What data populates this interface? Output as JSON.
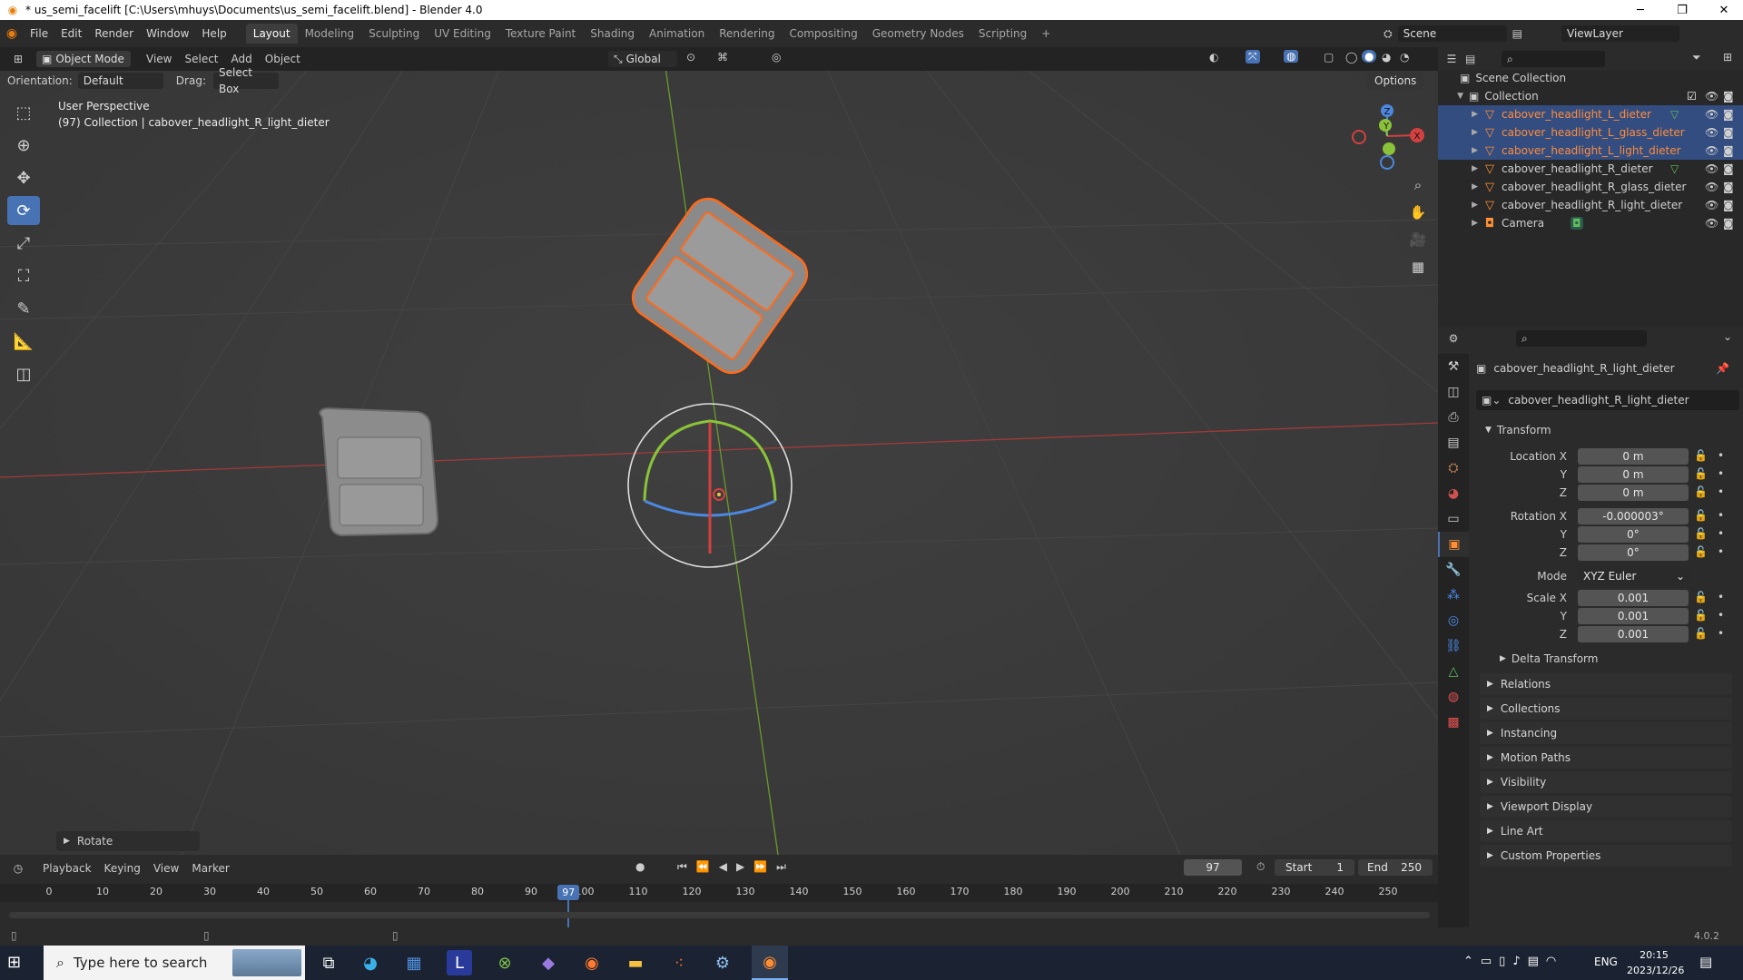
{
  "window": {
    "title": "* us_semi_facelift [C:\\Users\\mhuys\\Documents\\us_semi_facelift.blend] - Blender 4.0",
    "minimize": "─",
    "maximize": "❐",
    "close": "✕"
  },
  "menus": [
    "File",
    "Edit",
    "Render",
    "Window",
    "Help"
  ],
  "workspaces": [
    {
      "label": "Layout",
      "active": true
    },
    {
      "label": "Modeling"
    },
    {
      "label": "Sculpting"
    },
    {
      "label": "UV Editing"
    },
    {
      "label": "Texture Paint"
    },
    {
      "label": "Shading"
    },
    {
      "label": "Animation"
    },
    {
      "label": "Rendering"
    },
    {
      "label": "Compositing"
    },
    {
      "label": "Geometry Nodes"
    },
    {
      "label": "Scripting"
    },
    {
      "label": "+"
    }
  ],
  "scene": {
    "label": "Scene",
    "viewlayer": "ViewLayer"
  },
  "viewport_header": {
    "mode": "Object Mode",
    "menus": [
      "View",
      "Select",
      "Add",
      "Object"
    ],
    "transform": "Global"
  },
  "tool_header": {
    "orientation_label": "Orientation:",
    "orientation_value": "Default",
    "drag_label": "Drag:",
    "drag_value": "Select Box",
    "options": "Options"
  },
  "overlay": {
    "line1": "User Perspective",
    "line2": "(97) Collection | cabover_headlight_R_light_dieter"
  },
  "gizmo": {
    "z": "Z",
    "y": "Y",
    "x": "X"
  },
  "last_operator": "Rotate",
  "timeline": {
    "menus": [
      "Playback",
      "Keying",
      "View",
      "Marker"
    ],
    "current_frame": "97",
    "start_label": "Start",
    "start": "1",
    "end_label": "End",
    "end": "250",
    "ticks": [
      "0",
      "10",
      "20",
      "30",
      "40",
      "50",
      "60",
      "70",
      "80",
      "90",
      "100",
      "110",
      "120",
      "130",
      "140",
      "150",
      "160",
      "170",
      "180",
      "190",
      "200",
      "210",
      "220",
      "230",
      "240",
      "250"
    ]
  },
  "outliner": {
    "root": "Scene Collection",
    "collection": "Collection",
    "items": [
      {
        "name": "cabover_headlight_L_dieter",
        "selected": true,
        "mod": true
      },
      {
        "name": "cabover_headlight_L_glass_dieter",
        "selected": true
      },
      {
        "name": "cabover_headlight_L_light_dieter",
        "selected": true
      },
      {
        "name": "cabover_headlight_R_dieter",
        "selected": false,
        "mod": true
      },
      {
        "name": "cabover_headlight_R_glass_dieter",
        "selected": false
      },
      {
        "name": "cabover_headlight_R_light_dieter",
        "selected": false
      },
      {
        "name": "Camera",
        "selected": false,
        "camera": true
      }
    ]
  },
  "properties": {
    "object_name": "cabover_headlight_R_light_dieter",
    "datablock": "cabover_headlight_R_light_dieter",
    "transform_label": "Transform",
    "location": {
      "label": "Location X",
      "x": "0 m",
      "y": "0 m",
      "z": "0 m"
    },
    "rotation": {
      "label": "Rotation X",
      "x": "-0.000003°",
      "y": "0°",
      "z": "0°"
    },
    "mode_label": "Mode",
    "mode": "XYZ Euler",
    "scale": {
      "label": "Scale X",
      "x": "0.001",
      "y": "0.001",
      "z": "0.001"
    },
    "axis_y": "Y",
    "axis_z": "Z",
    "delta": "Delta Transform",
    "sections": [
      "Relations",
      "Collections",
      "Instancing",
      "Motion Paths",
      "Visibility",
      "Viewport Display",
      "Line Art",
      "Custom Properties"
    ]
  },
  "status": {
    "version": "4.0.2"
  },
  "taskbar": {
    "search_placeholder": "Type here to search",
    "lang": "ENG",
    "time": "20:15",
    "date": "2023/12/26"
  },
  "colors": {
    "accent": "#4772b3",
    "selection": "#ff8c3a",
    "active_obj": "#ff6a1a"
  }
}
